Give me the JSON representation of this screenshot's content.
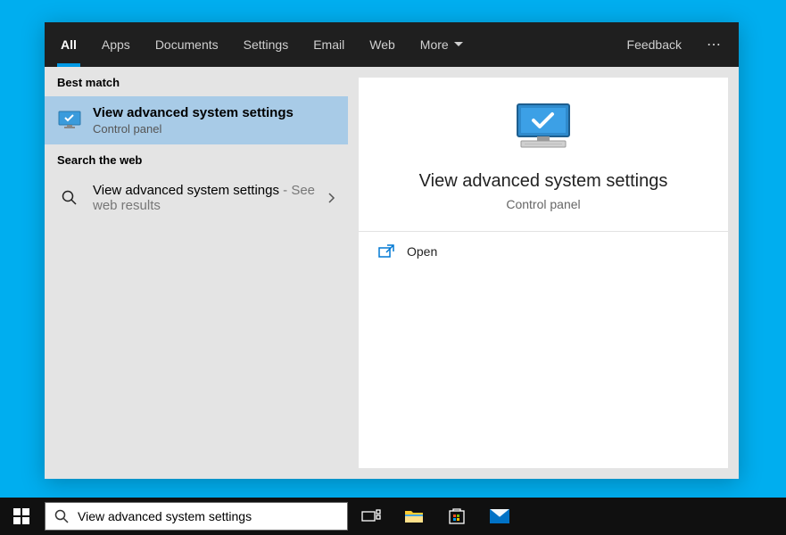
{
  "tabs": {
    "all": "All",
    "apps": "Apps",
    "documents": "Documents",
    "settings": "Settings",
    "email": "Email",
    "web": "Web",
    "more": "More"
  },
  "feedback": "Feedback",
  "left": {
    "best_match_header": "Best match",
    "best_result": {
      "title": "View advanced system settings",
      "subtitle": "Control panel"
    },
    "web_header": "Search the web",
    "web_result": {
      "title": "View advanced system settings",
      "suffix": " - See web results"
    }
  },
  "preview": {
    "title": "View advanced system settings",
    "subtitle": "Control panel",
    "open_label": "Open"
  },
  "search_value": "View advanced system settings"
}
